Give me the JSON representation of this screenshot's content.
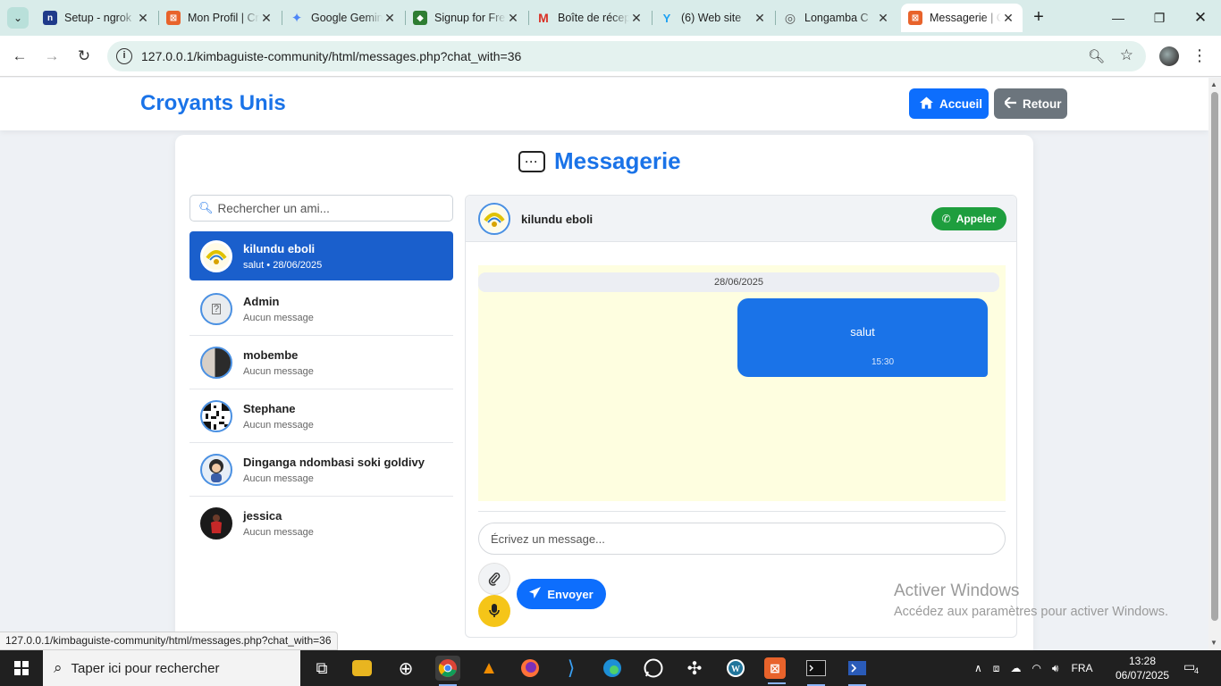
{
  "browser": {
    "tabs": [
      {
        "title": "Setup - ngrok",
        "favicon_text": "n",
        "favicon_color": "#1f3a8a"
      },
      {
        "title": "Mon Profil | Croyants",
        "favicon_text": "⊠",
        "favicon_color": "#e8632b"
      },
      {
        "title": "Google Gemini",
        "favicon_text": "✦",
        "favicon_color": "#4e86f7"
      },
      {
        "title": "Signup for Free",
        "favicon_text": "◆",
        "favicon_color": "#2e7d32"
      },
      {
        "title": "Boîte de réception",
        "favicon_text": "M",
        "favicon_color": "#d93025"
      },
      {
        "title": "(6) Web site",
        "favicon_text": "Y",
        "favicon_color": "#1da1f2"
      },
      {
        "title": "Longamba C",
        "favicon_text": "◎",
        "favicon_color": "#555555"
      },
      {
        "title": "Messagerie | C",
        "favicon_text": "⊠",
        "favicon_color": "#e8632b"
      }
    ],
    "url": "127.0.0.1/kimbaguiste-community/html/messages.php?chat_with=36",
    "status_url": "127.0.0.1/kimbaguiste-community/html/messages.php?chat_with=36"
  },
  "header": {
    "brand": "Croyants Unis",
    "home_label": "Accueil",
    "back_label": "Retour"
  },
  "page": {
    "title": "Messagerie",
    "search_placeholder": "Rechercher un ami..."
  },
  "contacts": [
    {
      "name": "kilundu eboli",
      "last": "salut •  28/06/2025",
      "avatar": "logo"
    },
    {
      "name": "Admin",
      "last": "Aucun message",
      "avatar": "broken"
    },
    {
      "name": "mobembe",
      "last": "Aucun message",
      "avatar": "photo"
    },
    {
      "name": "Stephane",
      "last": "Aucun message",
      "avatar": "qr"
    },
    {
      "name": "Dinganga ndombasi soki goldivy",
      "last": "Aucun message",
      "avatar": "cartoon"
    },
    {
      "name": "jessica",
      "last": "Aucun message",
      "avatar": "photo-red"
    }
  ],
  "chat": {
    "contact_name": "kilundu eboli",
    "call_label": "Appeler",
    "date_separator": "28/06/2025",
    "messages": [
      {
        "text": "salut",
        "time": "15:30",
        "outgoing": true
      }
    ],
    "input_placeholder": "Écrivez un message...",
    "send_label": "Envoyer"
  },
  "watermark": {
    "line1": "Activer Windows",
    "line2": "Accédez aux paramètres pour activer Windows."
  },
  "taskbar": {
    "search_placeholder": "Taper ici pour rechercher",
    "language": "FRA",
    "time": "13:28",
    "date": "06/07/2025",
    "notifications": "4"
  },
  "colors": {
    "accent": "#1a73e8",
    "active_contact": "#1a5fcc",
    "call_green": "#1e9e3e",
    "mic_yellow": "#f5c518",
    "chat_bg": "#fefee0"
  }
}
